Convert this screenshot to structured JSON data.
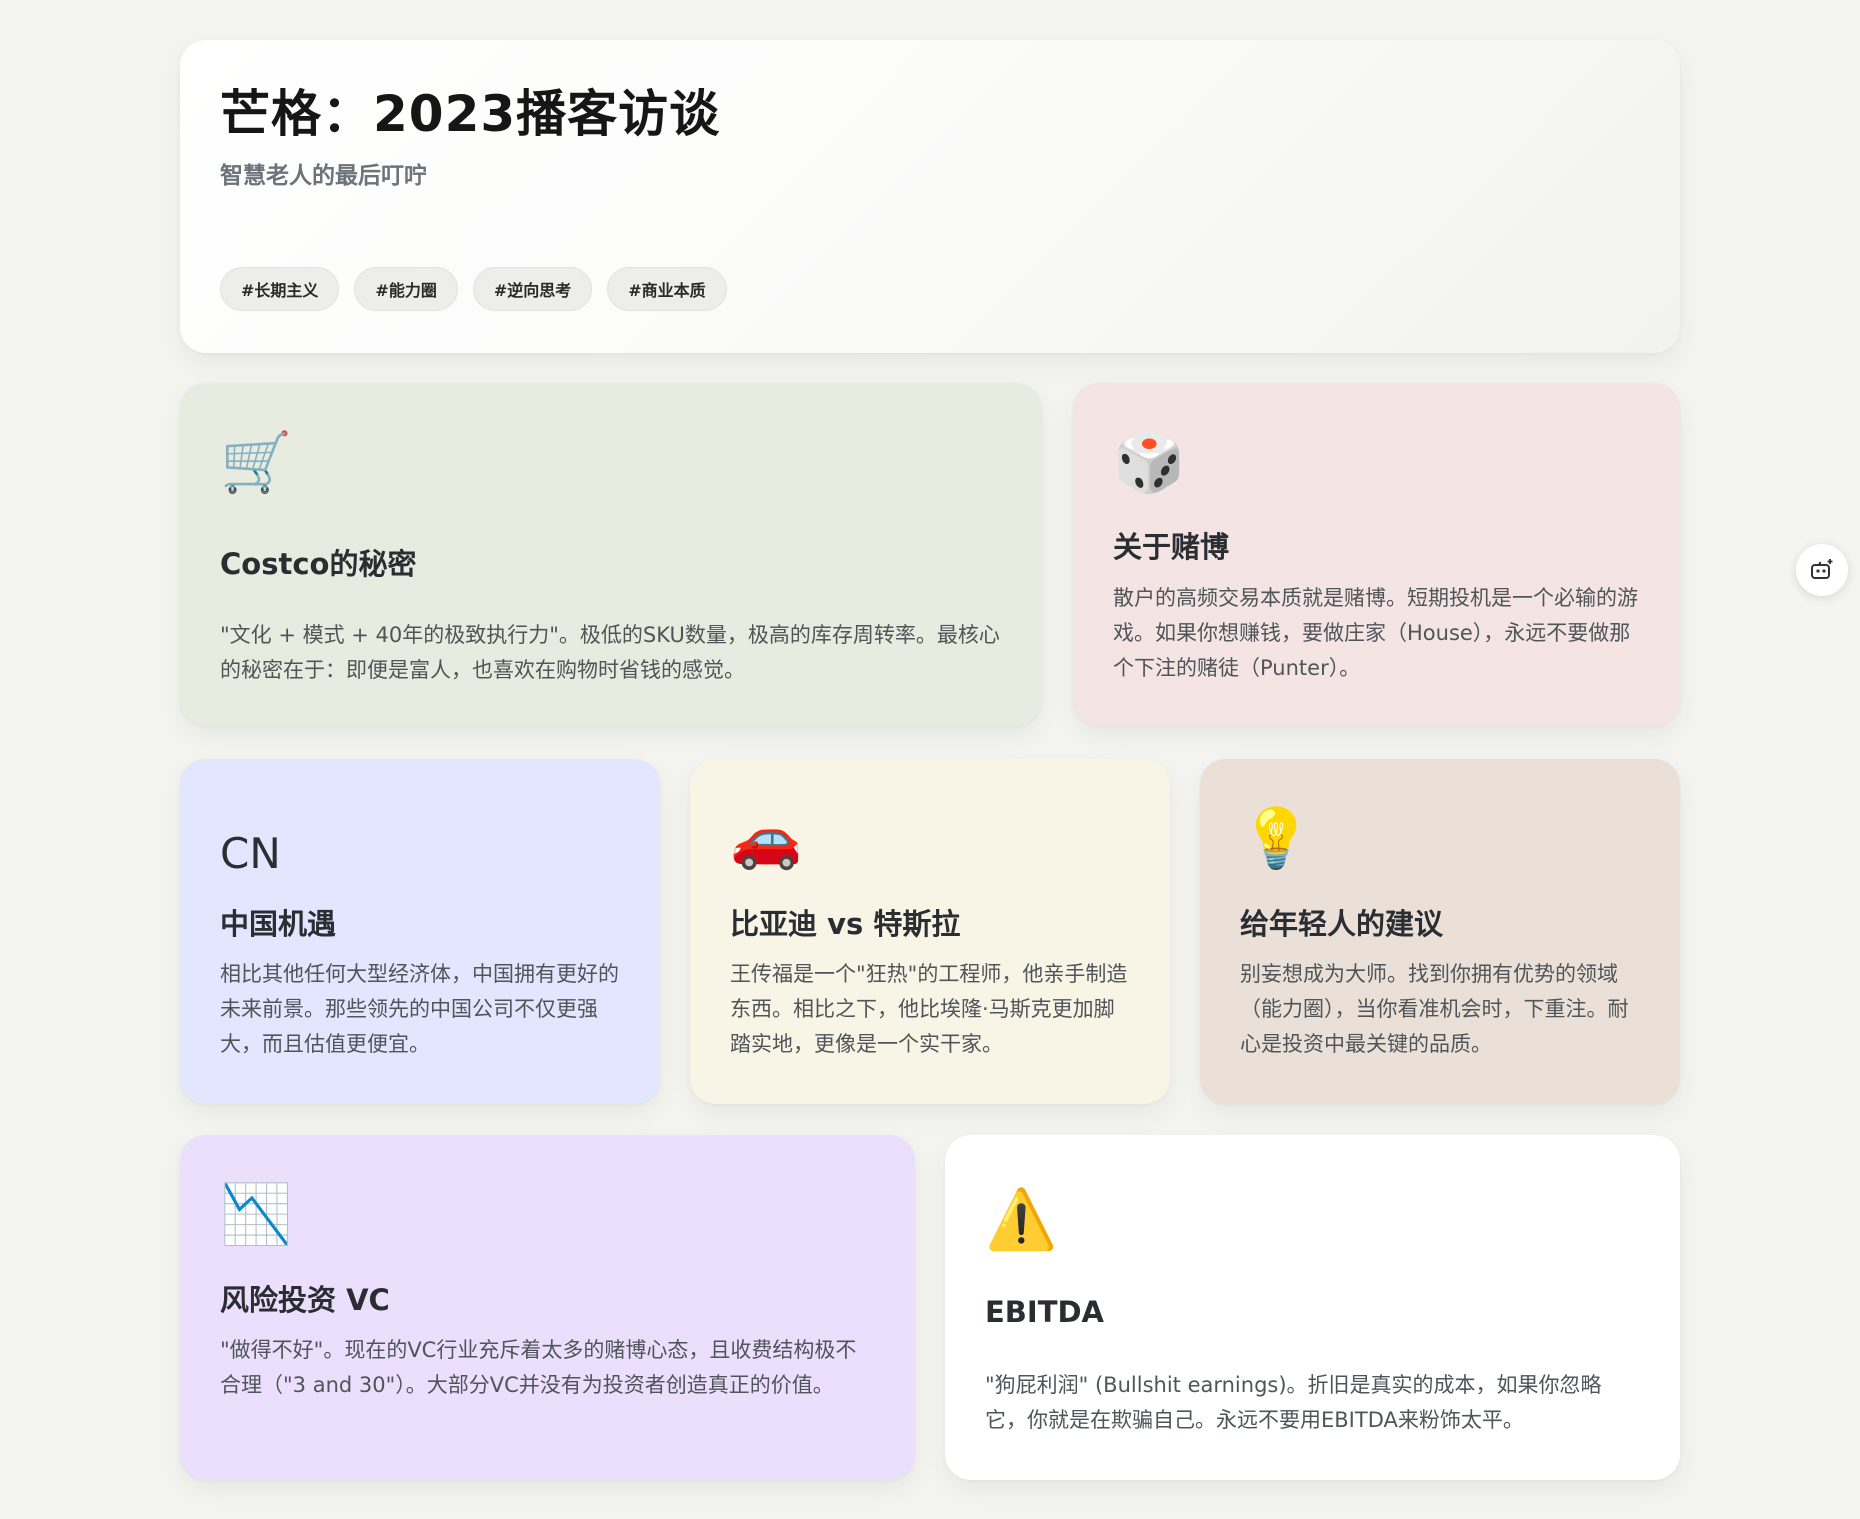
{
  "hero": {
    "title": "芒格：2023播客访谈",
    "subtitle": "智慧老人的最后叮咛",
    "tags": [
      "#长期主义",
      "#能力圈",
      "#逆向思考",
      "#商业本质"
    ]
  },
  "cards": {
    "costco": {
      "icon": "🛒",
      "icon_name": "shopping-cart-icon",
      "title": "Costco的秘密",
      "text": "\"文化 + 模式 + 40年的极致执行力\"。极低的SKU数量，极高的库存周转率。最核心的秘密在于：即便是富人，也喜欢在购物时省钱的感觉。",
      "color": "#e8ebdf"
    },
    "gambling": {
      "icon": "🎲",
      "icon_name": "dice-icon",
      "title": "关于赌博",
      "text": "散户的高频交易本质就是赌博。短期投机是一个必输的游戏。如果你想赚钱，要做庄家（House），永远不要做那个下注的赌徒（Punter）。",
      "color": "#f4e4e4"
    },
    "china": {
      "icon": "CN",
      "icon_name": "cn-flag-icon",
      "title": "中国机遇",
      "text": "相比其他任何大型经济体，中国拥有更好的未来前景。那些领先的中国公司不仅更强大，而且估值更便宜。",
      "color": "#e2e6ff"
    },
    "byd": {
      "icon": "🚗",
      "icon_name": "car-icon",
      "title": "比亚迪 vs 特斯拉",
      "text": "王传福是一个\"狂热\"的工程师，他亲手制造东西。相比之下，他比埃隆·马斯克更加脚踏实地，更像是一个实干家。",
      "color": "#f9f5e6"
    },
    "advice": {
      "icon": "💡",
      "icon_name": "light-bulb-icon",
      "title": "给年轻人的建议",
      "text": "别妄想成为大师。找到你拥有优势的领域（能力圈），当你看准机会时，下重注。耐心是投资中最关键的品质。",
      "color": "#ebe0d8"
    },
    "vc": {
      "icon": "📉",
      "icon_name": "chart-decreasing-icon",
      "title": "风险投资 VC",
      "text": "\"做得不好\"。现在的VC行业充斥着太多的赌博心态，且收费结构极不合理（\"3 and 30\"）。大部分VC并没有为投资者创造真正的价值。",
      "color": "#ebdffd"
    },
    "ebitda": {
      "icon": "⚠️",
      "icon_name": "warning-icon",
      "title": "EBITDA",
      "text": "\"狗屁利润\" (Bullshit earnings)。折旧是真实的成本，如果你忽略它，你就是在欺骗自己。永远不要用EBITDA来粉饰太平。",
      "color": "#ffffff"
    }
  }
}
